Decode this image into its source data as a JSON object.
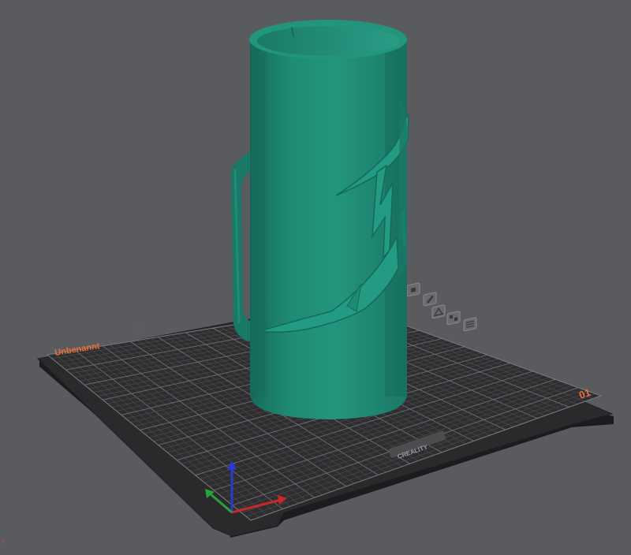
{
  "viewport": {
    "background": "#5a5b5f",
    "plate_name": "Unbenannt",
    "plate_number": "01",
    "brand_label": "CREALITY",
    "corner_marker": "x"
  },
  "colors": {
    "bed_top": "#2b2b2d",
    "bed_side": "#1c1c1e",
    "grid_minor": "#4a4a4d",
    "grid_major": "#6a6a6e",
    "model": "#1e8a73",
    "model_light": "#27a088",
    "model_dark": "#15695a",
    "plate_label": "#e8703a",
    "axis_x": "#c8282a",
    "axis_y": "#2aa13a",
    "axis_z": "#2a3ad0"
  },
  "plate_icons": [
    "lock-icon",
    "edit-icon",
    "orient-icon",
    "arrange-icon",
    "slice-icon"
  ],
  "model": {
    "name": "mug-with-lightning-pattern"
  }
}
